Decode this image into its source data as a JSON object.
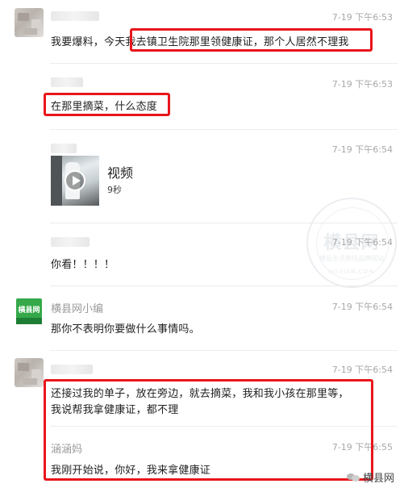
{
  "messages": [
    {
      "time": "7-19 下午6:53",
      "pre_text": "我要爆料，今天",
      "text": "我去镇卫生院那里领健康证，那个人居然不理我"
    },
    {
      "time": "7-19 下午6:53",
      "text": "在那里摘菜，什么态度"
    },
    {
      "time": "7-19 下午6:54",
      "video_label": "视频",
      "video_duration": "9秒"
    },
    {
      "time": "7-19 下午6:54",
      "text": "你看！！！！"
    },
    {
      "name": "横县网小编",
      "avatar_text": "横县网",
      "time": "7-19 下午6:54",
      "text": "那你不表明你要做什么事情吗。"
    },
    {
      "time": "7-19 下午6:54",
      "line1": "还接过我的单子，放在旁边，就去摘菜，我和我小孩在那里等，",
      "line2": "我说帮我拿健康证，都不理"
    },
    {
      "name": "涵涵妈",
      "time": "7-19 下午6:55",
      "text": "我刚开始说，你好，我来拿健康证"
    }
  ],
  "watermark": {
    "title": "横县网",
    "subtitle": "横县生活资讯品牌网站",
    "bottom": "HGXIAN.COM"
  },
  "brand": "横县网",
  "colors": {
    "highlight": "#e8151b",
    "logo_green": "#35a94a"
  }
}
